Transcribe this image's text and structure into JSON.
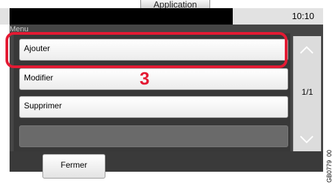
{
  "header": {
    "tab_label": "Application",
    "time": "10:10"
  },
  "panel": {
    "title": "Menu"
  },
  "menu": {
    "items": [
      {
        "label": "Ajouter"
      },
      {
        "label": "Modifier"
      },
      {
        "label": "Supprimer"
      }
    ]
  },
  "pager": {
    "indicator": "1/1"
  },
  "footer": {
    "close_label": "Fermer"
  },
  "annotation": {
    "step": "3",
    "highlight_color": "#e41a33",
    "doc_code": "GB0779_00"
  },
  "icons": {
    "scroll_up": "chevron-up-icon",
    "scroll_down": "chevron-down-icon"
  }
}
